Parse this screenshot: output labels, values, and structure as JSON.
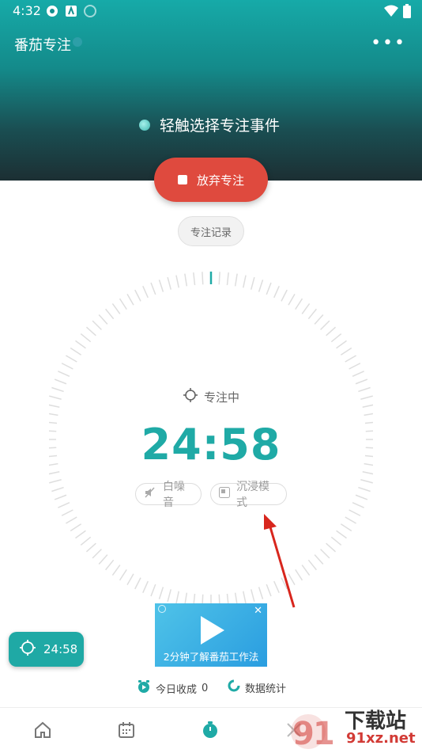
{
  "status_bar": {
    "time": "4:32"
  },
  "header": {
    "title": "番茄专注",
    "event_prompt": "轻触选择专注事件"
  },
  "actions": {
    "quit_label": "放弃专注",
    "record_label": "专注记录"
  },
  "timer": {
    "state_label": "专注中",
    "time": "24:58"
  },
  "chips": {
    "white_noise": "白噪音",
    "immersive": "沉浸模式"
  },
  "float_timer": {
    "time": "24:58"
  },
  "ad": {
    "caption": "2分钟了解番茄工作法",
    "close": "✕"
  },
  "stats": {
    "today_label": "今日收成",
    "today_value": "0",
    "data_label": "数据统计"
  },
  "watermark": {
    "top": "下载站",
    "bottom": "91xz.net"
  },
  "colors": {
    "accent": "#1faaa6",
    "danger": "#df4a3e"
  }
}
